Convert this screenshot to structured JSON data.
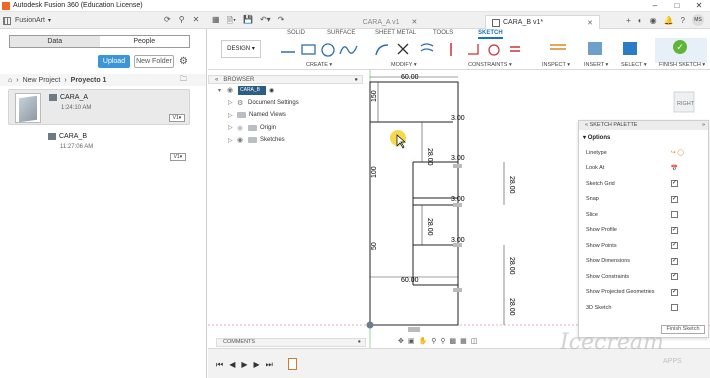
{
  "window": {
    "title": "Autodesk Fusion 360 (Education License)",
    "controls": [
      "–",
      "□",
      "✕"
    ]
  },
  "brand": {
    "name": "FusionArt"
  },
  "tabs": [
    {
      "label": "CARA_A v1",
      "active": false
    },
    {
      "label": "CARA_B v1*",
      "active": true
    }
  ],
  "data_panel": {
    "segments": [
      {
        "label": "Data",
        "active": true
      },
      {
        "label": "People",
        "active": false
      }
    ],
    "upload_label": "Upload",
    "new_folder_label": "New Folder",
    "breadcrumb": {
      "parent": "New Project",
      "current": "Proyecto 1"
    },
    "files": [
      {
        "name": "CARA_A",
        "time": "1:24:10 AM",
        "version": "V1",
        "selected": true
      },
      {
        "name": "CARA_B",
        "time": "11:27:06 AM",
        "version": "V1",
        "selected": false
      }
    ]
  },
  "toolbar": {
    "workspace_label": "DESIGN",
    "tabs": [
      {
        "label": "SOLID",
        "active": false
      },
      {
        "label": "SURFACE",
        "active": false
      },
      {
        "label": "SHEET METAL",
        "active": false
      },
      {
        "label": "TOOLS",
        "active": false
      },
      {
        "label": "SKETCH",
        "active": true
      }
    ],
    "groups": [
      "CREATE",
      "MODIFY",
      "CONSTRAINTS",
      "INSPECT",
      "INSERT",
      "SELECT",
      "FINISH SKETCH"
    ],
    "accent": "#1a73b8"
  },
  "browser": {
    "title": "BROWSER",
    "component": "CARA_B v1",
    "items": [
      "Document Settings",
      "Named Views",
      "Origin",
      "Sketches"
    ]
  },
  "viewcube": {
    "face": "RIGHT"
  },
  "sketch": {
    "dimensions": [
      "60.00",
      "150",
      "100",
      "50",
      "60.00",
      "3.00",
      "3.00",
      "3.00",
      "3.00",
      "28.00",
      "28.00",
      "28.00",
      "28.00",
      "28.00"
    ]
  },
  "palette": {
    "title": "SKETCH PALETTE",
    "section": "Options",
    "options": [
      {
        "label": "Linetype",
        "type": "linetype"
      },
      {
        "label": "Look At",
        "type": "icon"
      },
      {
        "label": "Sketch Grid",
        "checked": true
      },
      {
        "label": "Snap",
        "checked": true
      },
      {
        "label": "Slice",
        "checked": false
      },
      {
        "label": "Show Profile",
        "checked": true
      },
      {
        "label": "Show Points",
        "checked": true
      },
      {
        "label": "Show Dimensions",
        "checked": true
      },
      {
        "label": "Show Constraints",
        "checked": true
      },
      {
        "label": "Show Projected Geometries",
        "checked": true
      },
      {
        "label": "3D Sketch",
        "checked": false
      }
    ],
    "finish_label": "Finish Sketch"
  },
  "comments": {
    "label": "COMMENTS"
  },
  "avatar": {
    "initials": "MS"
  },
  "watermark": {
    "brand": "Icecream",
    "sub": "APPS"
  }
}
